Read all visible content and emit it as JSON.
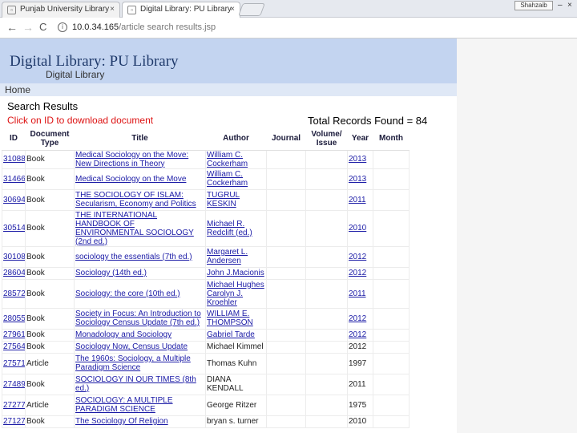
{
  "browser": {
    "tabs": [
      {
        "label": "Punjab University Library",
        "close": "×"
      },
      {
        "label": "Digital Library: PU Library",
        "close": "×"
      }
    ],
    "profile_label": "Shahzaib",
    "window_controls": {
      "minimize": "–",
      "restore": "❐",
      "close": "×"
    },
    "nav": {
      "back": "←",
      "forward": "→",
      "reload": "C"
    },
    "url_host": "10.0.34.165",
    "url_path": "/article search results.jsp"
  },
  "header": {
    "title": "Digital Library: PU Library",
    "subtitle": "Digital Library"
  },
  "home_link": "Home",
  "search_results_heading": "Search Results",
  "hint": "Click on ID to download document",
  "total_records": "Total Records Found = 84",
  "table": {
    "columns": [
      "ID",
      "Document Type",
      "Title",
      "Author",
      "Journal",
      "Volume/ Issue",
      "Year",
      "Month"
    ],
    "rows": [
      {
        "id": "31088",
        "type": "Book",
        "title": "Medical Sociology on the Move: New Directions in Theory",
        "author": "William C. Cockerham",
        "journal": "",
        "volume": "",
        "year": "2013",
        "month": "",
        "h": "r2"
      },
      {
        "id": "31466",
        "type": "Book",
        "title": "Medical Sociology on the Move",
        "author": "William C. Cockerham",
        "journal": "",
        "volume": "",
        "year": "2013",
        "month": "",
        "h": "r1"
      },
      {
        "id": "30694",
        "type": "Book",
        "title": "THE SOCIOLOGY OF ISLAM: Secularism, Economy and Politics",
        "author": "TUGRUL KESKIN",
        "journal": "",
        "volume": "",
        "year": "2011",
        "month": "",
        "h": "r1"
      },
      {
        "id": "30514",
        "type": "Book",
        "title": "THE INTERNATIONAL HANDBOOK OF ENVIRONMENTAL SOCIOLOGY (2nd ed.)",
        "author": "Michael R. Redclift (ed.)",
        "journal": "",
        "volume": "",
        "year": "2010",
        "month": "",
        "h": "r3"
      },
      {
        "id": "30108",
        "type": "Book",
        "title": "sociology the essentials (7th ed.)",
        "author": "Margaret L. Andersen",
        "journal": "",
        "volume": "",
        "year": "2012",
        "month": "",
        "h": "r1"
      },
      {
        "id": "28604",
        "type": "Book",
        "title": "Sociology (14th ed.)",
        "author": "John J.Macionis",
        "journal": "",
        "volume": "",
        "year": "2012",
        "month": "",
        "h": "r4"
      },
      {
        "id": "28572",
        "type": "Book",
        "title": "Sociology: the core (10th ed.)",
        "author": "Michael Hughes Carolyn J. Kroehler",
        "journal": "",
        "volume": "",
        "year": "2011",
        "month": "",
        "h": "r3"
      },
      {
        "id": "28055",
        "type": "Book",
        "title": "Society in Focus: An Introduction to Sociology Census Update (7th ed.)",
        "author": "WILLIAM E. THOMPSON",
        "journal": "",
        "volume": "",
        "year": "2012",
        "month": "",
        "h": "r1"
      },
      {
        "id": "27961",
        "type": "Book",
        "title": "Monadology and Sociology",
        "author": "Gabriel Tarde",
        "journal": "",
        "volume": "",
        "year": "2012",
        "month": "",
        "h": "r4"
      },
      {
        "id": "27564",
        "type": "Book",
        "title": "Sociology Now, Census Update",
        "author": "Michael Kimmel",
        "journal": "",
        "volume": "",
        "year": "2012",
        "month": "",
        "h": "r4"
      },
      {
        "id": "27571",
        "type": "Article",
        "title": "The 1960s: Sociology, a Multiple Paradigm Science",
        "author": "Thomas Kuhn",
        "journal": "",
        "volume": "",
        "year": "1997",
        "month": "",
        "h": "r1"
      },
      {
        "id": "27489",
        "type": "Book",
        "title": "SOCIOLOGY IN OUR TIMES (8th ed.)",
        "author": "DIANA KENDALL",
        "journal": "",
        "volume": "",
        "year": "2011",
        "month": "",
        "h": "r1"
      },
      {
        "id": "27277",
        "type": "Article",
        "title": "SOCIOLOGY: A MULTIPLE PARADIGM SCIENCE",
        "author": "George Ritzer",
        "journal": "",
        "volume": "",
        "year": "1975",
        "month": "",
        "h": "r1"
      },
      {
        "id": "27127",
        "type": "Book",
        "title": "The Sociology Of Religion",
        "author": "bryan s. turner",
        "journal": "",
        "volume": "",
        "year": "2010",
        "month": "",
        "h": "r4"
      }
    ]
  }
}
